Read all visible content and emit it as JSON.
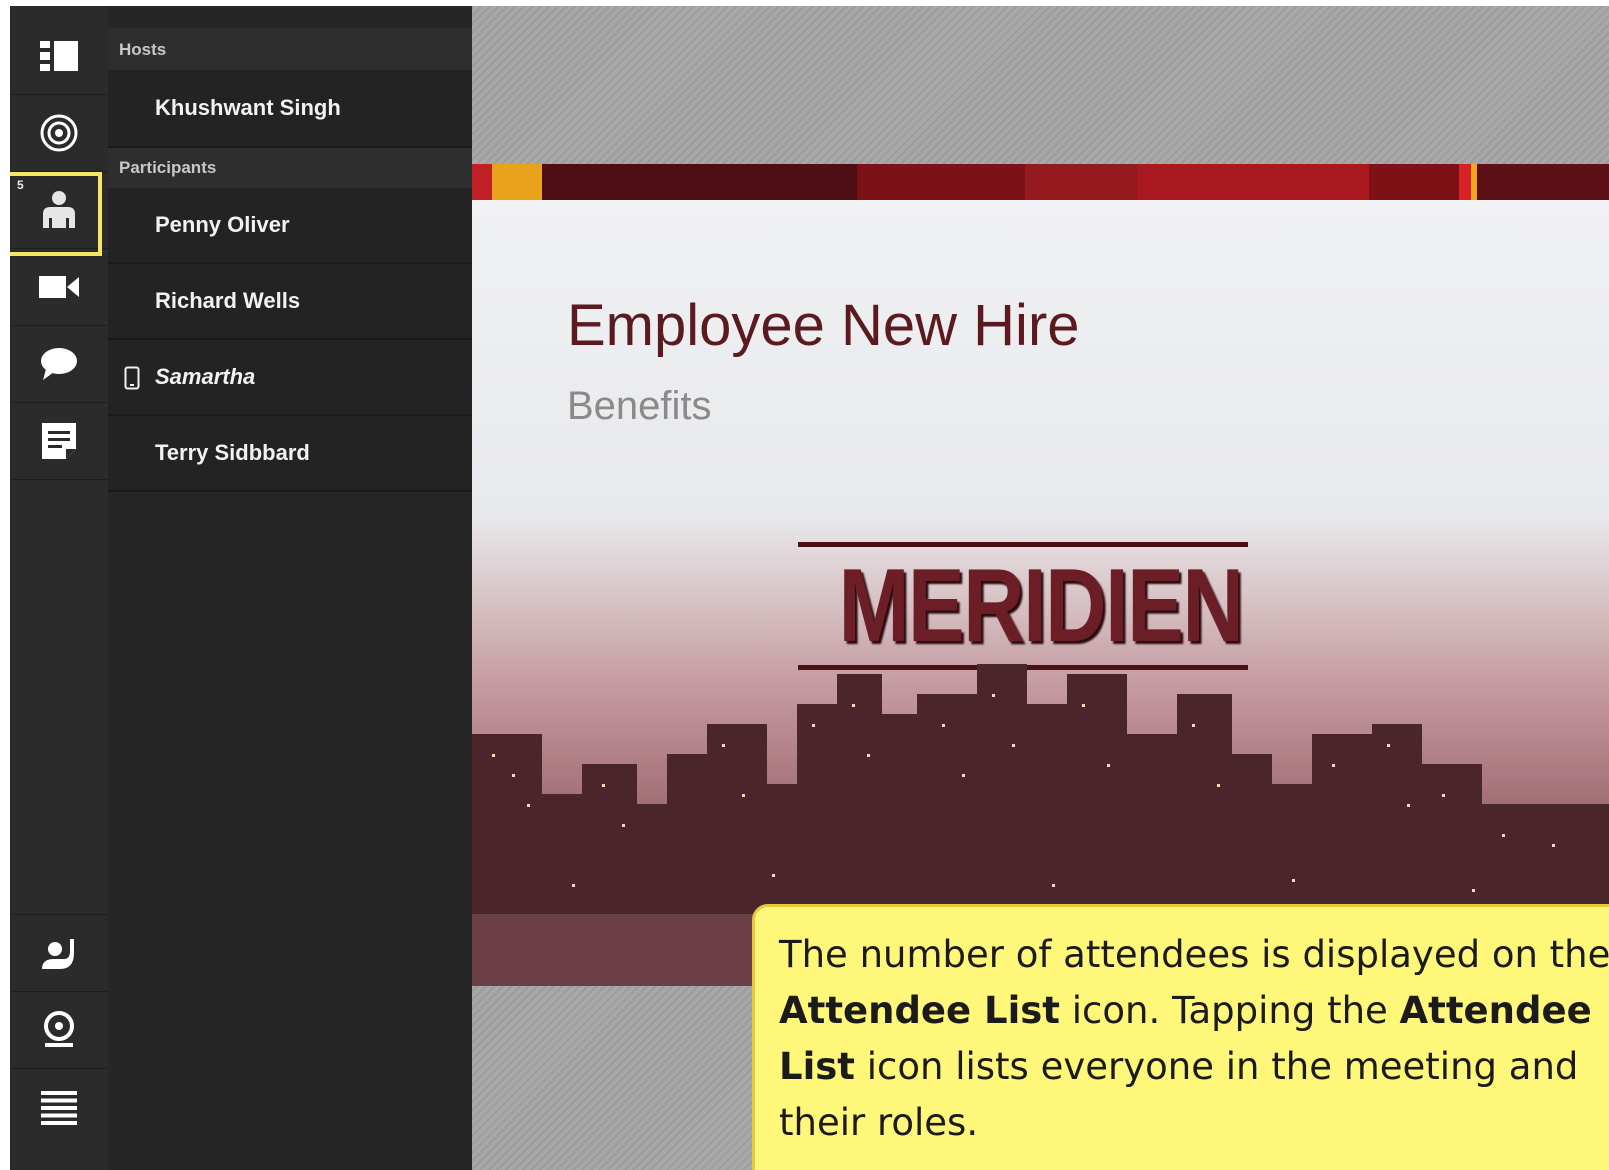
{
  "rail": {
    "items": [
      {
        "icon": "layout-icon"
      },
      {
        "icon": "target-icon"
      },
      {
        "icon": "attendee-list-icon",
        "badge": "5"
      },
      {
        "icon": "video-icon"
      },
      {
        "icon": "chat-icon"
      },
      {
        "icon": "notes-icon"
      }
    ],
    "bottom_items": [
      {
        "icon": "raise-hand-icon"
      },
      {
        "icon": "webcam-icon"
      },
      {
        "icon": "menu-icon"
      }
    ]
  },
  "attendees": {
    "hosts_header": "Hosts",
    "hosts": [
      "Khushwant Singh"
    ],
    "participants_header": "Participants",
    "participants": [
      {
        "name": "Penny Oliver",
        "mobile": false
      },
      {
        "name": "Richard Wells",
        "mobile": false
      },
      {
        "name": "Samartha",
        "mobile": true
      },
      {
        "name": "Terry Sidbbard",
        "mobile": false
      }
    ]
  },
  "slide": {
    "title": "Employee New Hire",
    "subtitle": "Benefits",
    "logo_text": "MERIDIEN"
  },
  "callout": {
    "t1": "The number of attendees is displayed on the ",
    "b1": "Attendee List",
    "t2": " icon. Tapping the ",
    "b2": "Attendee List",
    "t3": " icon lists everyone in the meeting and their roles."
  },
  "colors": {
    "accent_highlight": "#f5e663",
    "callout_bg": "#fff77a",
    "slide_title": "#5a1a1f",
    "brand_red": "#8b1a1f"
  }
}
